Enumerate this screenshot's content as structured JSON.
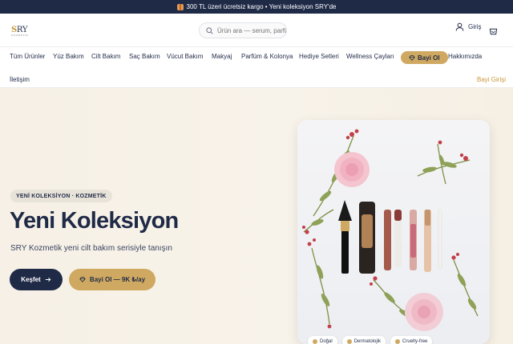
{
  "topbar": {
    "text": "300 TL üzeri ücretsiz kargo • Yeni koleksiyon SRY'de"
  },
  "header": {
    "logo_text": "SRY",
    "search_placeholder": "Ürün ara — serum, parfü",
    "login_label": "Giriş"
  },
  "nav": {
    "items": [
      "Tüm Ürünler",
      "Yüz Bakım",
      "Cilt Bakım",
      "Saç Bakım",
      "Vücut Bakım",
      "Makyaj",
      "Parfüm & Kolonya",
      "Hediye Setleri",
      "Wellness Çayları"
    ],
    "bayi_ol": "Bayi Ol",
    "hakkimizda": "Hakkımızda",
    "iletisim": "İletişim",
    "bayi_girisi": "Bayi Girişi"
  },
  "hero": {
    "badge": "YENİ KOLEKSİYON · KOZMETİK",
    "title": "Yeni Koleksiyon",
    "subtitle": "SRY Kozmetik yeni cilt bakım serisiyle tanışın",
    "cta_primary": "Keşfet",
    "cta_secondary": "Bayi Ol — 9K ₺/ay",
    "chips": [
      "Doğal",
      "Dermatolojik",
      "Cruelty-free"
    ]
  },
  "colors": {
    "navy": "#1f2a47",
    "gold": "#cfa961",
    "cream": "#f6f0e6"
  },
  "icons": [
    "gift-icon",
    "search-icon",
    "user-icon",
    "cart-icon",
    "diamond-icon",
    "arrow-right-icon"
  ]
}
